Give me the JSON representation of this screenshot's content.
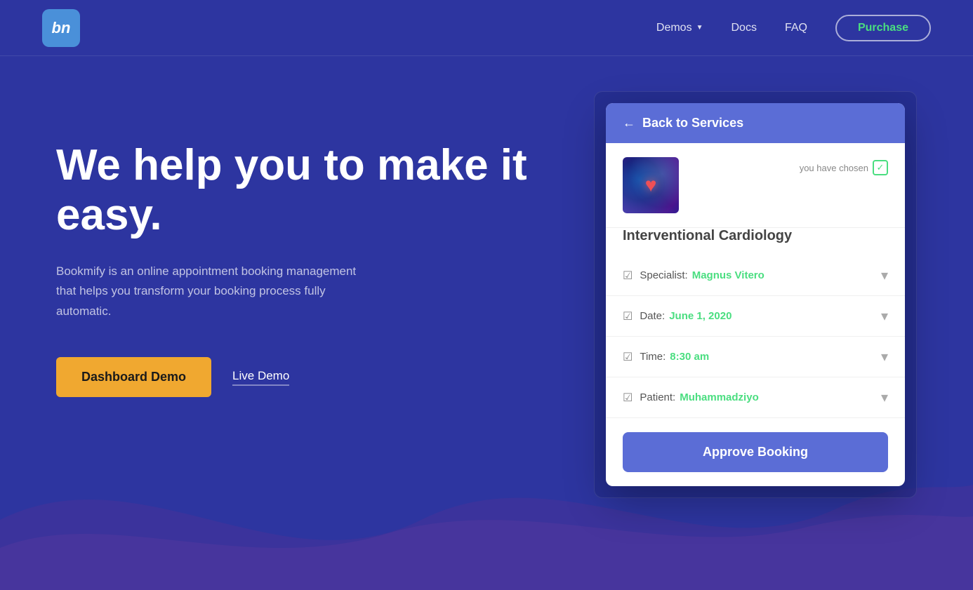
{
  "nav": {
    "logo": "bn",
    "links": [
      {
        "label": "Demos",
        "hasDropdown": true
      },
      {
        "label": "Docs",
        "hasDropdown": false
      },
      {
        "label": "FAQ",
        "hasDropdown": false
      }
    ],
    "purchase_label": "Purchase"
  },
  "hero": {
    "heading": "We help you to make it easy.",
    "subtext": "Bookmify is an online appointment booking management that helps you transform your booking process fully automatic.",
    "cta_primary": "Dashboard Demo",
    "cta_secondary": "Live Demo"
  },
  "booking": {
    "back_label": "Back to Services",
    "chosen_label": "you have chosen",
    "service_name": "Interventional Cardiology",
    "fields": [
      {
        "label": "Specialist:",
        "value": "Magnus Vitero"
      },
      {
        "label": "Date:",
        "value": "June 1, 2020"
      },
      {
        "label": "Time:",
        "value": "8:30 am"
      },
      {
        "label": "Patient:",
        "value": "Muhammadziyo"
      }
    ],
    "approve_label": "Approve Booking"
  }
}
